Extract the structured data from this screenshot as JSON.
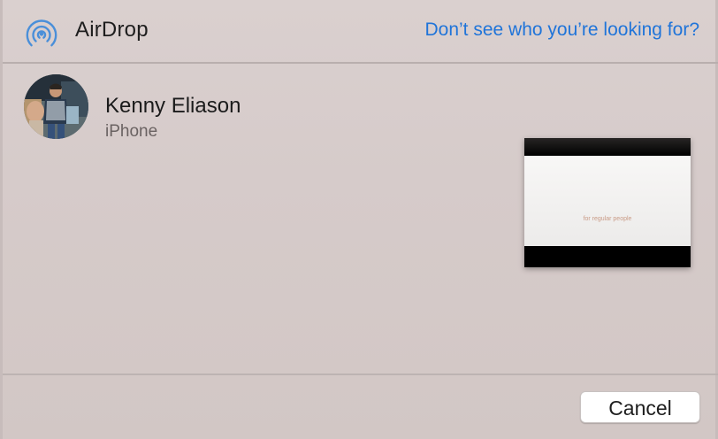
{
  "header": {
    "title": "AirDrop",
    "icon": "airdrop-icon",
    "help_link": "Don’t see who you’re looking for?"
  },
  "recipients": [
    {
      "name": "Kenny Eliason",
      "device": "iPhone",
      "avatar": "person-photo"
    }
  ],
  "preview": {
    "caption": "for regular people"
  },
  "footer": {
    "cancel_label": "Cancel"
  },
  "colors": {
    "accent": "#1f74d9",
    "background": "#d6cbca",
    "icon_blue": "#4a8fd9"
  }
}
